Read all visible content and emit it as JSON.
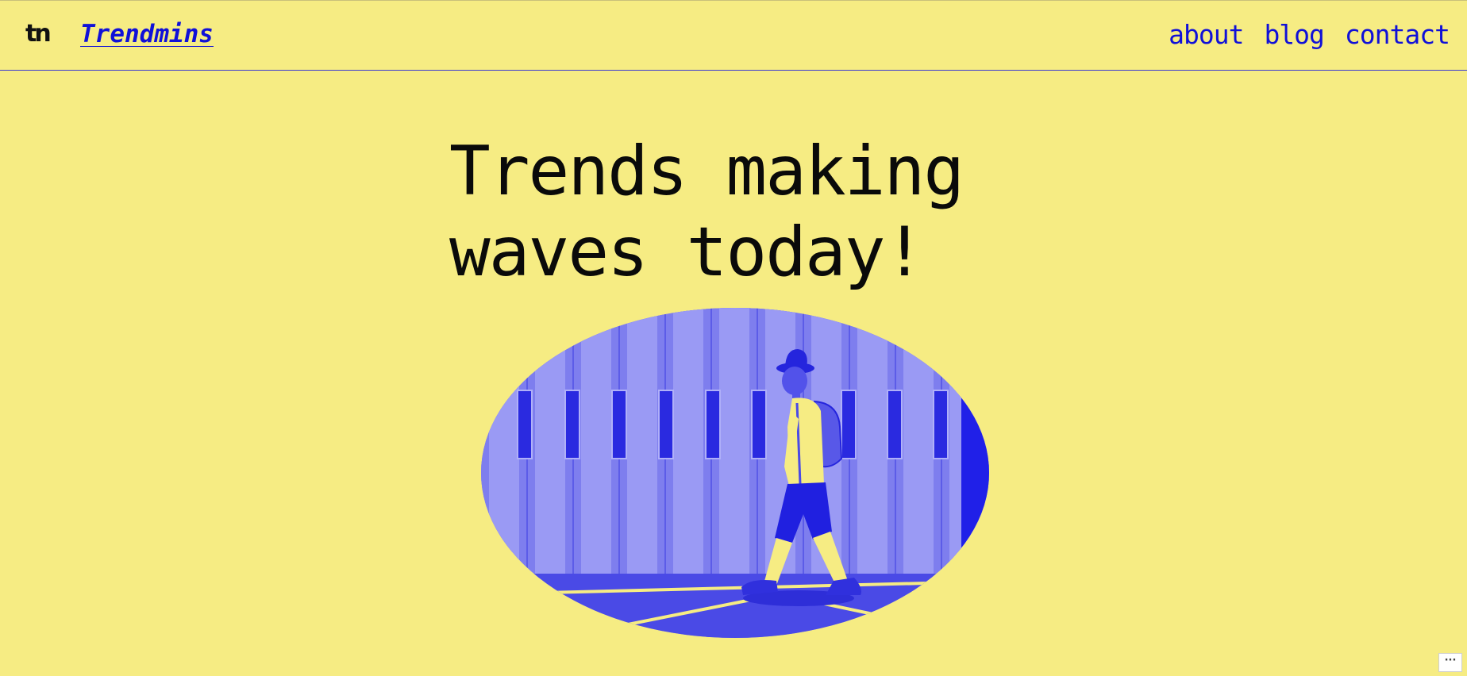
{
  "header": {
    "logo_text": "tn",
    "site_title": "Trendmins",
    "nav": [
      {
        "label": "about"
      },
      {
        "label": "blog"
      },
      {
        "label": "contact"
      }
    ]
  },
  "hero": {
    "title_line1": "Trends making",
    "title_line2": "waves today!"
  },
  "more_button": {
    "label": "···"
  },
  "colors": {
    "background": "#f6ec83",
    "accent": "#1010d8",
    "text": "#0a0a0a",
    "image_tint": "#5a5af0"
  },
  "icons": {
    "more": "ellipsis-icon"
  }
}
